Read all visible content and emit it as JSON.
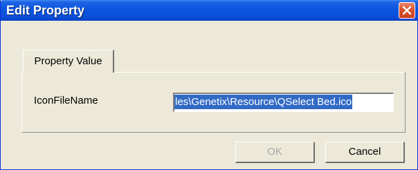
{
  "window": {
    "title": "Edit Property",
    "close_icon": "close-icon"
  },
  "tabs": [
    {
      "label": "Property Value",
      "selected": true
    }
  ],
  "field": {
    "label": "IconFileName",
    "value": "les\\Genetix\\Resource\\QSelect Bed.ico"
  },
  "buttons": {
    "ok_label": "OK",
    "ok_disabled": true,
    "cancel_label": "Cancel"
  },
  "colors": {
    "titlebar": "#0a55e0",
    "dialog_background": "#ece9d8",
    "selection": "#316ac5",
    "close_button": "#d9532c"
  }
}
